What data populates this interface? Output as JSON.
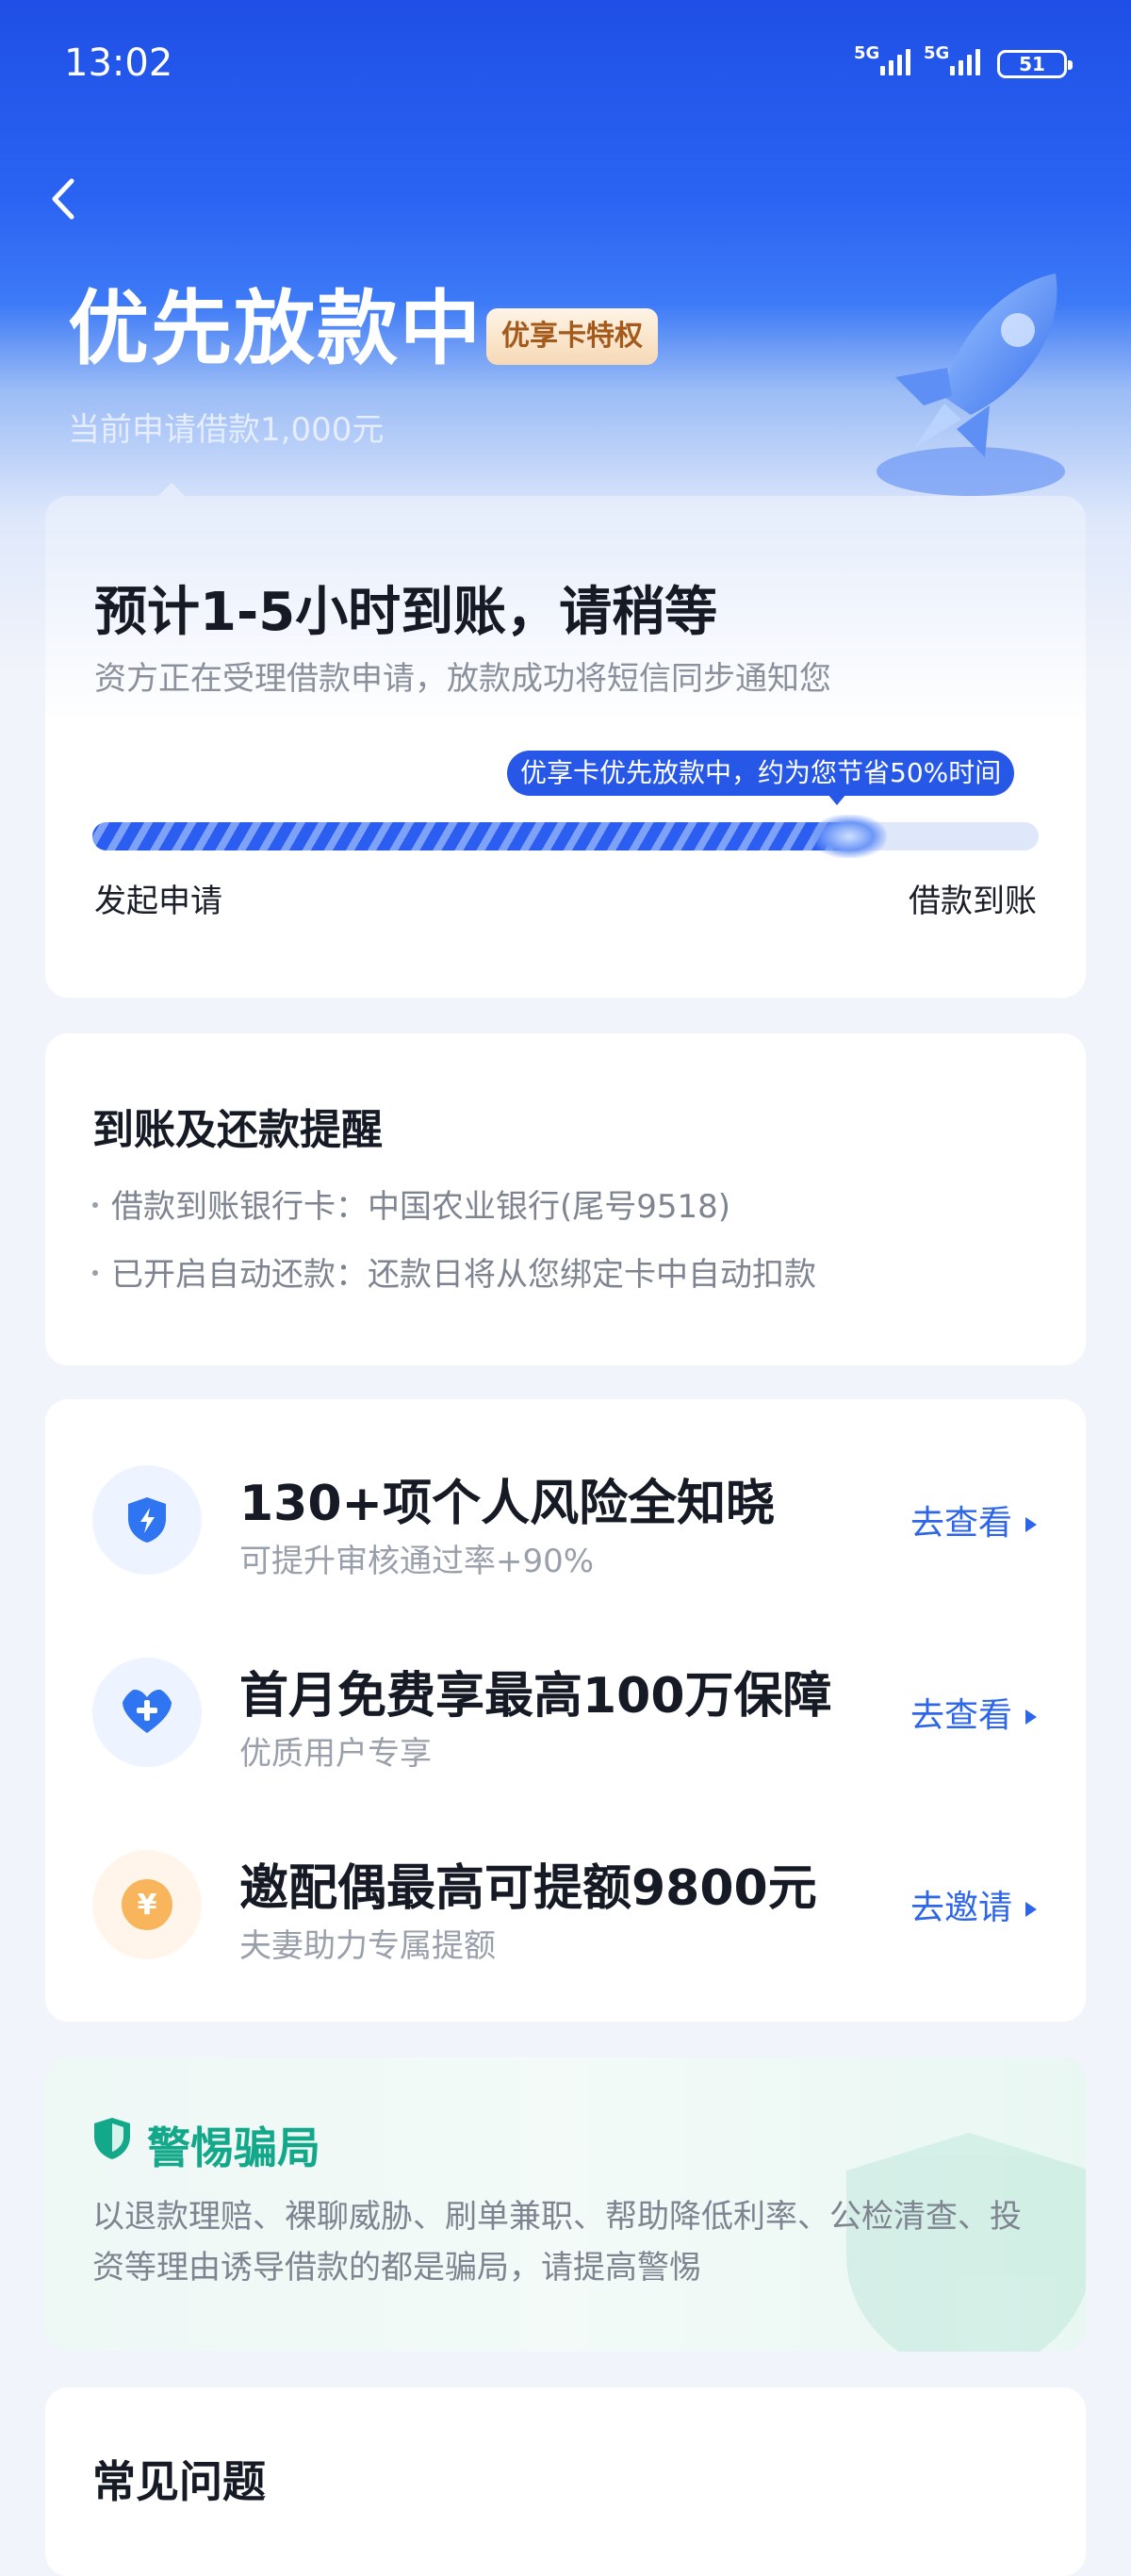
{
  "status_bar": {
    "time": "13:02",
    "signal1": "5G",
    "signal2": "5G",
    "battery": "51"
  },
  "header": {
    "title": "优先放款中",
    "badge": "优享卡特权",
    "subtitle": "当前申请借款1,000元"
  },
  "progress_card": {
    "title": "预计1-5小时到账，请稍等",
    "description": "资方正在受理借款申请，放款成功将短信同步通知您",
    "tip": "优享卡优先放款中，约为您节省50%时间",
    "progress": 0.82,
    "start_label": "发起申请",
    "end_label": "借款到账"
  },
  "reminder_card": {
    "title": "到账及还款提醒",
    "items": [
      "借款到账银行卡：中国农业银行(尾号9518)",
      "已开启自动还款：还款日将从您绑定卡中自动扣款"
    ]
  },
  "services": [
    {
      "title": "130+项个人风险全知晓",
      "subtitle": "可提升审核通过率+90%",
      "action": "去查看",
      "icon": "shield-bolt-icon"
    },
    {
      "title": "首月免费享最高100万保障",
      "subtitle": "优质用户专享",
      "action": "去查看",
      "icon": "heart-plus-icon"
    },
    {
      "title": "邀配偶最高可提额9800元",
      "subtitle": "夫妻助力专属提额",
      "action": "去邀请",
      "icon": "yuan-coin-icon"
    }
  ],
  "warning_card": {
    "title": "警惕骗局",
    "text": "以退款理赔、裸聊威胁、刷单兼职、帮助降低利率、公检清查、投资等理由诱导借款的都是骗局，请提高警惕"
  },
  "faq_card": {
    "title": "常见问题"
  },
  "colors": {
    "primary": "#2757e6",
    "link": "#2d66e8",
    "warning_green": "#14a88a",
    "badge_text": "#a45a1b"
  }
}
